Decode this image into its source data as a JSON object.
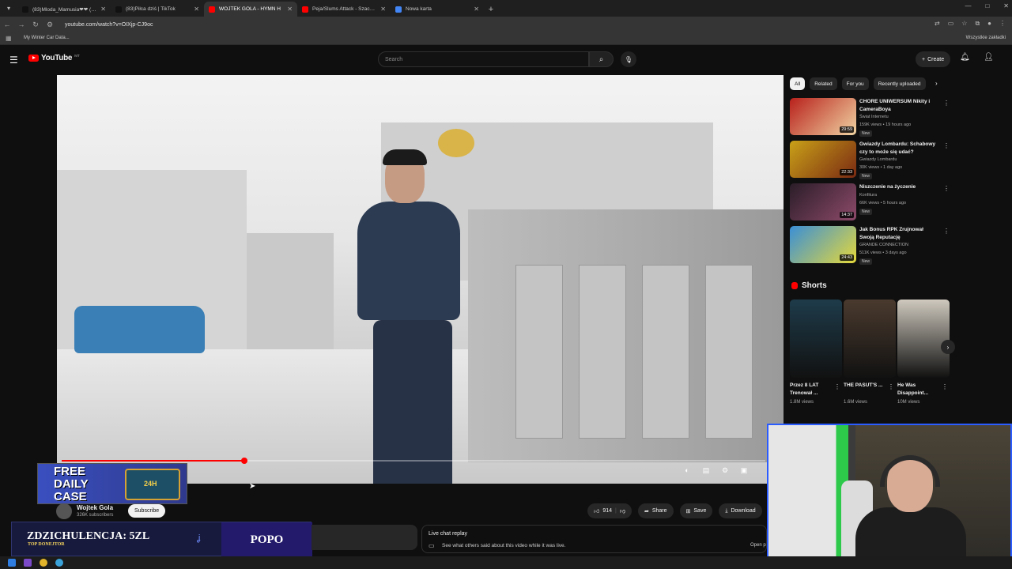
{
  "browser": {
    "tabs": [
      {
        "title": "(83)Mloda_Mamusia❤❤ (@mam",
        "active": false,
        "icon": "tiktok-icon"
      },
      {
        "title": "(83)Piłca dziś | TikTok",
        "active": false,
        "icon": "tiktok-icon"
      },
      {
        "title": "WOJTEK GOLA - HYMN H",
        "active": true,
        "icon": "youtube-icon"
      },
      {
        "title": "Peja/Slums Attack - Szacunek",
        "active": false,
        "icon": "youtube-icon"
      },
      {
        "title": "Nowa karta",
        "active": false,
        "icon": "chrome-icon"
      }
    ],
    "url": "youtube.com/watch?v=OIXjp-CJ9oc",
    "bookmark": "My Winter Car Data...",
    "all_bookmarks": "Wszystkie zakładki"
  },
  "youtube": {
    "logo_text": "YouTube",
    "country_code": "MT",
    "search_placeholder": "Search",
    "create_label": "Create"
  },
  "video": {
    "progress_fraction": 0.26,
    "channel_name": "Wojtek Gola",
    "subscribers": "326K subscribers",
    "subscribe_label": "Subscribe",
    "likes": "914",
    "share_label": "Share",
    "save_label": "Save",
    "download_label": "Download"
  },
  "ad_overlay": {
    "line1": "FREE",
    "line2": "DAILY",
    "line3": "CASE",
    "badge": "24H"
  },
  "donation": {
    "headline": "ZDZICHULENCJA: 5ZL",
    "subline": "TOP DONEJTOR",
    "right_text": "POPO"
  },
  "live_chat": {
    "title": "Live chat replay",
    "description": "See what others said about this video while it was live.",
    "open_label": "Open p"
  },
  "sidebar": {
    "chips": [
      "All",
      "Related",
      "For you",
      "Recently uploaded"
    ],
    "selected_chip": "All",
    "videos": [
      {
        "title": "CHORE UNIWERSUM Nikity i CameraBoya",
        "channel": "Świat Internetu",
        "meta": "159K views • 19 hours ago",
        "badge": "New",
        "duration": "29:59",
        "colors": [
          "#b8211c",
          "#f0d3a1"
        ]
      },
      {
        "title": "Gwiazdy Lombardu: Schabowy czy to może się udać?",
        "channel": "Gwiazdy Lombardu",
        "meta": "30K views • 1 day ago",
        "badge": "New",
        "duration": "22:33",
        "colors": [
          "#c9a118",
          "#7a2a12"
        ]
      },
      {
        "title": "Niszczenie na życzenie",
        "channel": "Konfitura",
        "meta": "66K views • 5 hours ago",
        "badge": "New",
        "duration": "14:37",
        "colors": [
          "#2a1d28",
          "#8d4a6a"
        ]
      },
      {
        "title": "Jak Bonus RPK Zrujnował Swoją Reputację",
        "channel": "GRANDE CONNECTION",
        "meta": "511K views • 3 days ago",
        "badge": "New",
        "duration": "24:43",
        "colors": [
          "#3a8fd6",
          "#e5d83b"
        ]
      }
    ],
    "shorts_title": "Shorts",
    "shorts": [
      {
        "title": "Przez 8 LAT Trenował ...",
        "views": "1.8M views",
        "color": "#1e3b4a"
      },
      {
        "title": "THE PASUT'S ...",
        "views": "1.6M views",
        "color": "#4a3a2e"
      },
      {
        "title": "He Was Disappoint...",
        "views": "10M views",
        "color": "#cfc9be"
      }
    ]
  }
}
